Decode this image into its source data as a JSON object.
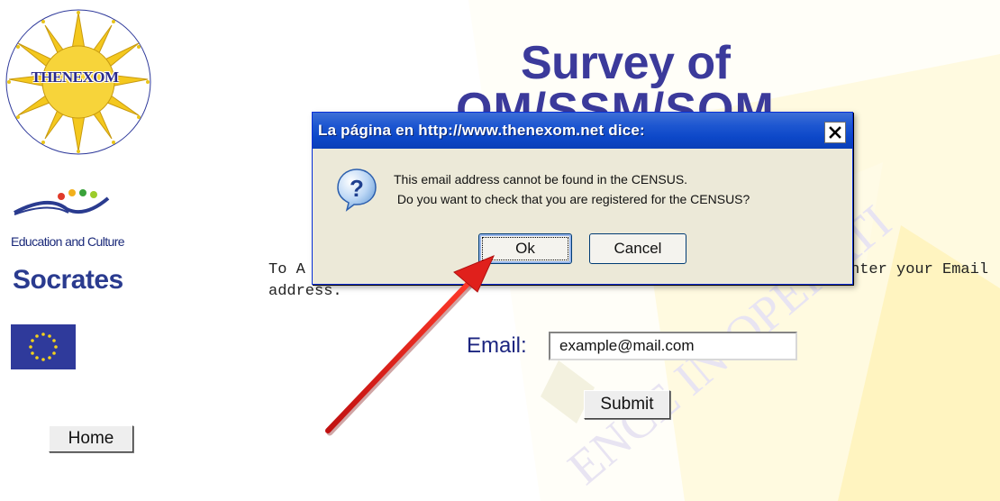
{
  "sidebar": {
    "logo_text": "THENEXOM",
    "edu_caption": "Education and Culture",
    "socrates_label": "Socrates",
    "home_label": "Home"
  },
  "main": {
    "title_line1": "Survey of",
    "title_line2": "OM/SSM/SOM",
    "intro_left": "To A",
    "intro_right": "nter your Email",
    "intro_line2": "address.",
    "email_label": "Email:",
    "email_value": "example@mail.com",
    "submit_label": "Submit"
  },
  "dialog": {
    "title": "La página en http://www.thenexom.net dice:",
    "message_line1": "This email address cannot be found in the CENSUS.",
    "message_line2": " Do you want to check that you are registered for the CENSUS?",
    "ok_label": "Ok",
    "cancel_label": "Cancel",
    "icon": "question-icon",
    "close_icon": "close-icon"
  },
  "colors": {
    "titlebar": "#0c47c8",
    "title_text": "#3b3a9b",
    "arrow": "#e0201c",
    "dialog_bg": "#ece9d8"
  }
}
